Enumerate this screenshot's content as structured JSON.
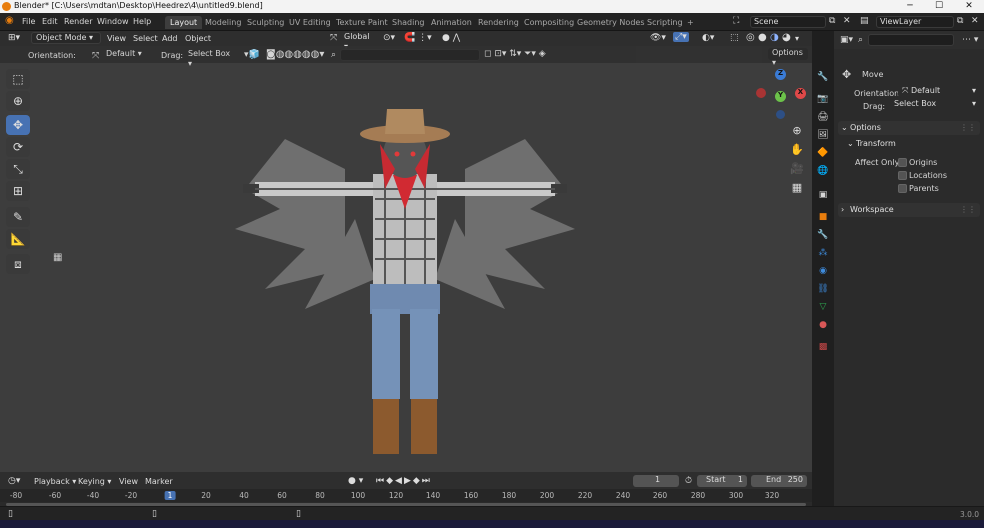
{
  "window": {
    "title": "Blender* [C:\\Users\\mdtan\\Desktop\\Heedrez\\4\\untitled9.blend]",
    "minimize": "─",
    "maximize": "☐",
    "close": "✕"
  },
  "menus": [
    "File",
    "Edit",
    "Render",
    "Window",
    "Help"
  ],
  "workspaces": [
    "Layout",
    "Modeling",
    "Sculpting",
    "UV Editing",
    "Texture Paint",
    "Shading",
    "Animation",
    "Rendering",
    "Compositing",
    "Geometry Nodes",
    "Scripting"
  ],
  "active_workspace": "Layout",
  "add_workspace": "+",
  "scene": {
    "label": "Scene",
    "view_layer": "ViewLayer"
  },
  "viewport_header": {
    "mode": "Object Mode",
    "menus": [
      "View",
      "Select",
      "Add",
      "Object"
    ],
    "transform_orientation": "Global",
    "options": "Options"
  },
  "tool_header": {
    "orientation_label": "Orientation:",
    "orientation_value": "Default",
    "drag_label": "Drag:",
    "drag_value": "Select Box"
  },
  "tools": [
    "cursor-select",
    "cursor",
    "move",
    "rotate",
    "scale",
    "transform",
    "annotate",
    "measure",
    "add-cube"
  ],
  "active_tool": "move",
  "props": {
    "tool_name": "Move",
    "orientation_label": "Orientation",
    "orientation_value": "Default",
    "drag_label": "Drag:",
    "drag_value": "Select Box",
    "options_panel": "Options",
    "transform_panel": "Transform",
    "affect_only_label": "Affect Only",
    "checkboxes": [
      "Origins",
      "Locations",
      "Parents"
    ],
    "workspace_panel": "Workspace"
  },
  "timeline": {
    "menus": [
      "Playback",
      "Keying",
      "View",
      "Marker"
    ],
    "current_frame": "1",
    "start_label": "Start",
    "start_value": "1",
    "end_label": "End",
    "end_value": "250",
    "ticks": [
      "-80",
      "-60",
      "-40",
      "-20",
      "1",
      "20",
      "40",
      "60",
      "80",
      "100",
      "120",
      "140",
      "160",
      "180",
      "200",
      "220",
      "240",
      "260",
      "280",
      "300",
      "320"
    ],
    "current_tick": "1"
  },
  "status": {
    "version": "3.0.0"
  },
  "gizmo": {
    "z": "Z",
    "y": "Y",
    "x": "X"
  },
  "colors": {
    "accent": "#4772b3",
    "brand": "#e87d0d",
    "viewport_bg": "#3d3d3d"
  }
}
